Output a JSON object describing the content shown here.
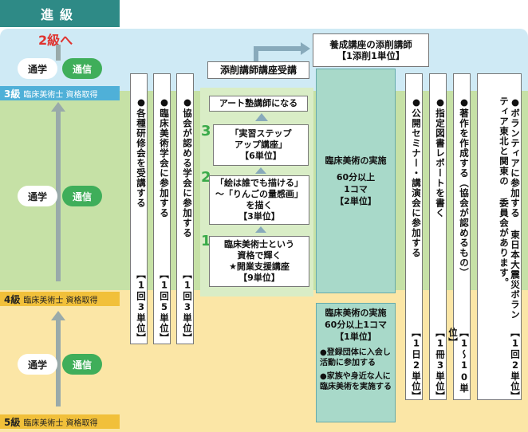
{
  "header": {
    "title": "進級",
    "next_level": "2級へ"
  },
  "pills": {
    "tsugaku": "通学",
    "tsushin": "通信"
  },
  "levels": [
    {
      "grade": "3級",
      "label": "臨床美術士 資格取得"
    },
    {
      "grade": "4級",
      "label": "臨床美術士 資格取得"
    },
    {
      "grade": "5級",
      "label": "臨床美術士 資格取得"
    }
  ],
  "vertical_cols": [
    {
      "text": "●各種研修会を受講する",
      "units": "【1回3単位】"
    },
    {
      "text": "●臨床美術学会に参加する",
      "units": "【1回5単位】"
    },
    {
      "text": "●協会が認める学会に参加する",
      "units": "【1回3単位】"
    },
    {
      "text": "●公開セミナー・講演会に参加する",
      "units": "【1日2単位】"
    },
    {
      "text": "●指定図書レポートを書く",
      "units": "【1冊3単位】"
    },
    {
      "text": "●著作を作成する（協会が認めるもの）",
      "units": "【1〜10単位】"
    },
    {
      "text": "●ボランティアに参加する 東日本大震災ボランティア東北と関東の 委員会があります。",
      "units": "【1回2単位】"
    }
  ],
  "center": {
    "art_instructor": "アート塾講師になる",
    "step3_num": "3",
    "step3": [
      "「実習ステップ",
      "アップ講座」",
      "【6単位】"
    ],
    "step2_num": "2",
    "step2": [
      "「絵は誰でも描ける」",
      "〜「りんごの量感画」",
      "を描く",
      "【3単位】"
    ],
    "step1_num": "1",
    "step1": [
      "臨床美術士という",
      "資格で輝く",
      "★開業支援講座",
      "【9単位】"
    ],
    "tensaku_course": "添削講師講座受講",
    "training_title": "養成講座の添削講師",
    "training_units": "【1添削1単位】",
    "practice_green": [
      "臨床美術の実施",
      "60分以上",
      "1コマ",
      "【2単位】"
    ],
    "practice_yellow": [
      "臨床美術の実施",
      "60分以上1コマ",
      "【1単位】"
    ],
    "bullet1": "●登録団体に入会し活動に参加する",
    "bullet2": "●家族や身近な人に臨床美術を実施する"
  }
}
